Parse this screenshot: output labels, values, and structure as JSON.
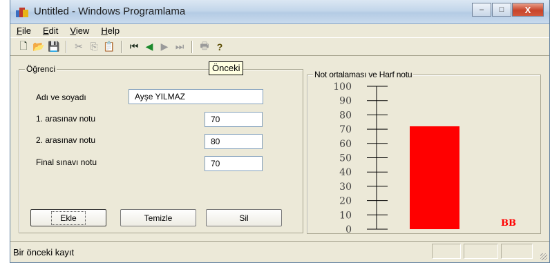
{
  "window": {
    "title": "Untitled - Windows Programlama",
    "controls": {
      "minimize": "–",
      "maximize": "□",
      "close": "X"
    }
  },
  "menu": [
    "File",
    "Edit",
    "View",
    "Help"
  ],
  "toolbar": {
    "buttons": [
      {
        "name": "new-icon",
        "glyph": "🗋",
        "state": "act"
      },
      {
        "name": "open-icon",
        "glyph": "📂",
        "state": "act"
      },
      {
        "name": "save-icon",
        "glyph": "💾",
        "state": "act"
      },
      {
        "name": "cut-icon",
        "glyph": "✂",
        "state": "dis"
      },
      {
        "name": "copy-icon",
        "glyph": "⎘",
        "state": "dis"
      },
      {
        "name": "paste-icon",
        "glyph": "📋",
        "state": "dis"
      },
      {
        "name": "first-record-icon",
        "glyph": "⏮",
        "state": "act"
      },
      {
        "name": "previous-record-icon",
        "glyph": "◀",
        "state": "green"
      },
      {
        "name": "next-record-icon",
        "glyph": "▶",
        "state": "dis"
      },
      {
        "name": "last-record-icon",
        "glyph": "⏭",
        "state": "dis"
      },
      {
        "name": "print-icon",
        "glyph": "🖶",
        "state": "dis"
      },
      {
        "name": "help-icon",
        "glyph": "?",
        "state": "act"
      }
    ],
    "tooltip": "Önceki"
  },
  "student": {
    "group_title": "Öğrenci",
    "name_label": "Adı ve soyadı",
    "name_value": "Ayşe YILMAZ",
    "exam1_label": "1. arasınav notu",
    "exam1_value": "70",
    "exam2_label": "2. arasınav notu",
    "exam2_value": "80",
    "final_label": "Final sınavı notu",
    "final_value": "70"
  },
  "buttons": {
    "add": "Ekle",
    "clear": "Temizle",
    "delete": "Sil"
  },
  "chart_data": {
    "type": "bar",
    "title": "Not ortalaması ve Harf notu",
    "ylim": [
      0,
      100
    ],
    "ticks": [
      0,
      10,
      20,
      30,
      40,
      50,
      60,
      70,
      80,
      90,
      100
    ],
    "values": [
      72
    ],
    "bar_color": "#ff0000",
    "letter_grade": "BB",
    "letter_color": "#ff0000"
  },
  "status": {
    "text": "Bir önceki kayıt"
  }
}
